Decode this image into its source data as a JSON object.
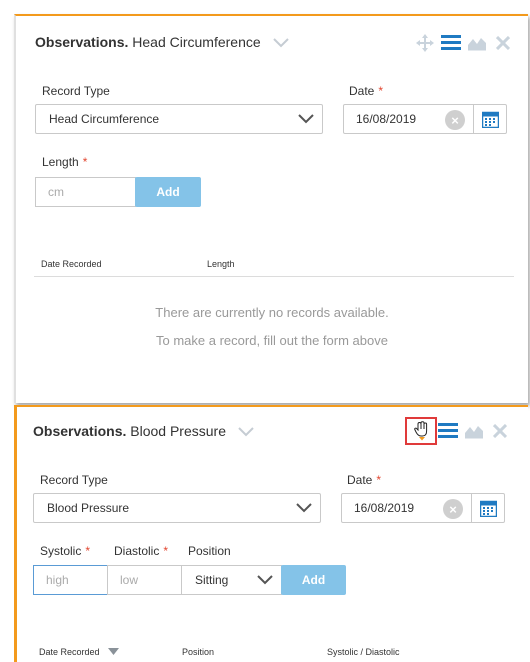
{
  "panel1": {
    "title_bold": "Observations.",
    "title_rest": "Head Circumference",
    "tool_icons": [
      "move-icon",
      "list-icon",
      "chart-icon",
      "close-icon"
    ],
    "record_type_label": "Record Type",
    "record_type_value": "Head Circumference",
    "date_label": "Date",
    "date_value": "16/08/2019",
    "required_mark": "*",
    "length_label": "Length",
    "length_placeholder": "cm",
    "add_label": "Add",
    "col_date": "Date Recorded",
    "col_length": "Length",
    "empty_line1": "There are currently no records available.",
    "empty_line2": "To make a record, fill out the form above"
  },
  "panel2": {
    "title_bold": "Observations.",
    "title_rest": "Blood Pressure",
    "tool_icons": [
      "drag-hand-icon",
      "list-icon",
      "chart-icon",
      "close-icon"
    ],
    "record_type_label": "Record Type",
    "record_type_value": "Blood Pressure",
    "date_label": "Date",
    "date_value": "16/08/2019",
    "required_mark": "*",
    "systolic_label": "Systolic",
    "diastolic_label": "Diastolic",
    "position_label": "Position",
    "systolic_placeholder": "high",
    "diastolic_placeholder": "low",
    "position_value": "Sitting",
    "add_label": "Add",
    "col_date": "Date Recorded",
    "col_position": "Position",
    "col_sys_dia": "Systolic / Diastolic"
  },
  "colors": {
    "accent_orange": "#f39a1c",
    "primary_blue": "#1f7ac2",
    "button_blue": "#84c3e8",
    "required_red": "#e2452f",
    "highlight_red": "#e03a3a"
  }
}
